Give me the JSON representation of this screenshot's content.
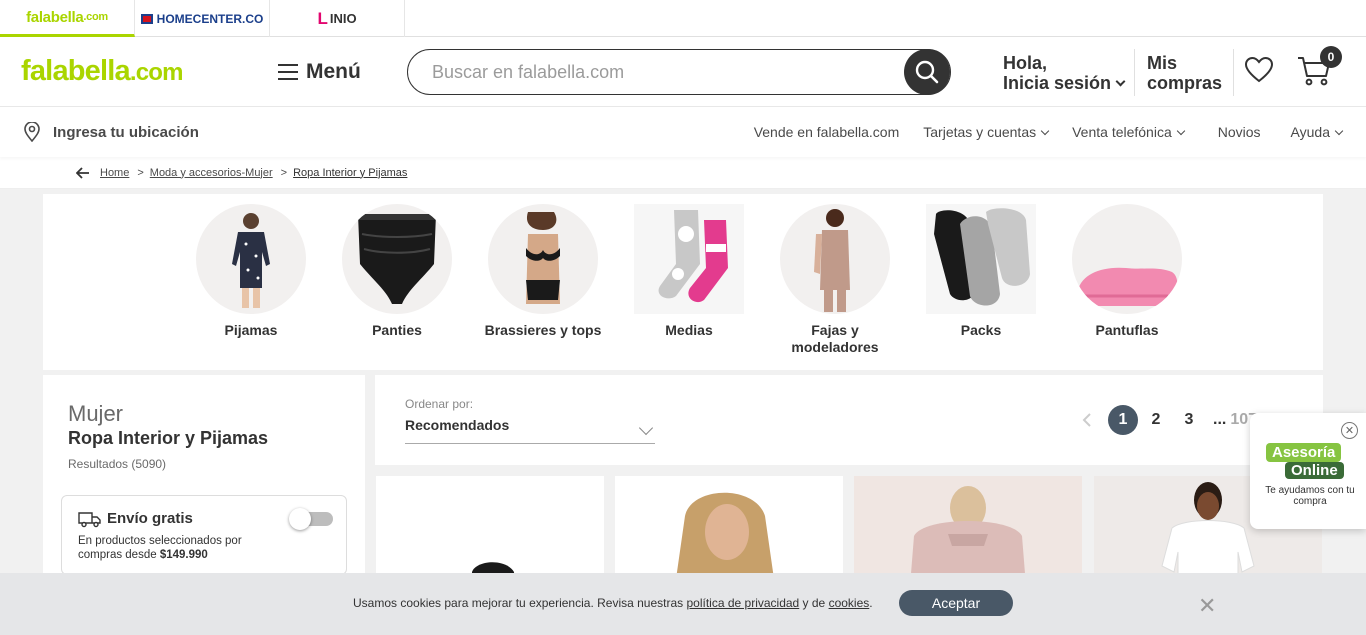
{
  "brands": {
    "falabella": "falabella",
    "falabella_tld": ".com",
    "homecenter": "HOMECENTER.CO",
    "linio_l": "L",
    "linio_rest": "INIO"
  },
  "header": {
    "logo": "falabella",
    "logo_tld": ".com",
    "menu_label": "Menú",
    "search_placeholder": "Buscar en falabella.com",
    "login_line1": "Hola,",
    "login_line2": "Inicia sesión",
    "compras_line1": "Mis",
    "compras_line2": "compras",
    "cart_count": "0"
  },
  "locbar": {
    "location": "Ingresa tu ubicación",
    "links": [
      "Vende en falabella.com",
      "Tarjetas y cuentas",
      "Venta telefónica",
      "Novios",
      "Ayuda"
    ]
  },
  "breadcrumb": {
    "items": [
      "Home",
      "Moda y accesorios-Mujer",
      "Ropa Interior y Pijamas"
    ],
    "separator": ">"
  },
  "categories": [
    {
      "label": "Pijamas",
      "icon": "pajamas-photo"
    },
    {
      "label": "Panties",
      "icon": "panties-photo"
    },
    {
      "label": "Brassieres y tops",
      "icon": "bra-photo"
    },
    {
      "label": "Medias",
      "icon": "socks-photo"
    },
    {
      "label": "Fajas y modeladores",
      "icon": "shapewear-photo"
    },
    {
      "label": "Packs",
      "icon": "packs-photo"
    },
    {
      "label": "Pantuflas",
      "icon": "slippers-photo"
    }
  ],
  "sidebar": {
    "category": "Mujer",
    "title": "Ropa Interior y Pijamas",
    "results": "Resultados (5090)",
    "free_shipping": {
      "title": "Envío gratis",
      "desc_prefix": "En productos seleccionados por compras desde ",
      "desc_amount": "$149.990",
      "enabled": false
    }
  },
  "results_header": {
    "sort_label": "Ordenar por:",
    "sort_value": "Recomendados",
    "pages": [
      "1",
      "2",
      "3"
    ],
    "ellipsis": "...",
    "last_page": "107",
    "active_page": "1"
  },
  "asesoria": {
    "line1": "Asesoría",
    "line2": "Online",
    "sub": "Te ayudamos con tu compra",
    "close": "✕"
  },
  "cookie": {
    "msg_prefix": "Usamos cookies para mejorar tu experiencia. Revisa nuestras ",
    "link1": "política de privacidad",
    "middle": " y de ",
    "link2": "cookies",
    "suffix": ".",
    "accept": "Aceptar",
    "close": "✕"
  },
  "colors": {
    "brand_green": "#aad500",
    "dark": "#333333",
    "pager_active": "#495867",
    "homecenter_blue": "#1b3f8b",
    "linio_pink": "#e2066f"
  }
}
